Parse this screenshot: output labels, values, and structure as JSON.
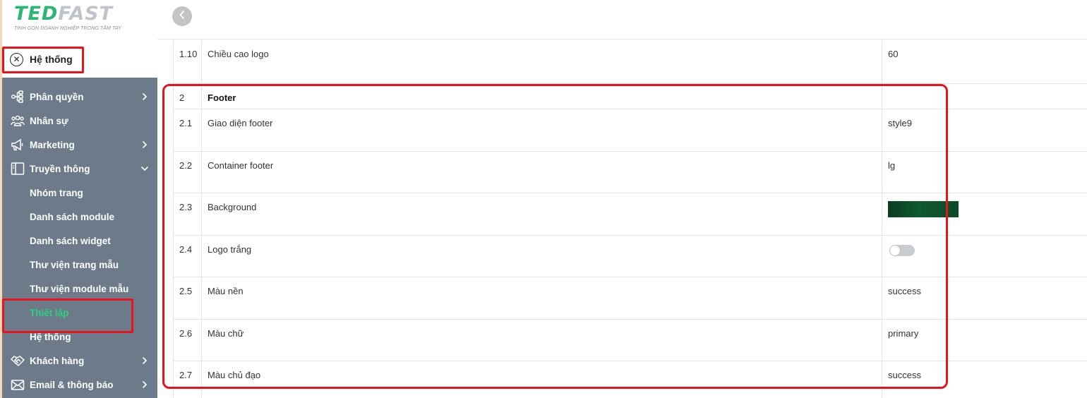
{
  "brand": {
    "logo_text_1": "TED",
    "logo_text_2": "FAST",
    "tagline": "TINH GỌN DOANH NGHIỆP TRONG TẦM TAY",
    "accent_color": "#2bb673",
    "highlight_color": "#e8141c"
  },
  "sidebar": {
    "header_label": "Hệ thống",
    "header_icon": "close-circle-icon",
    "items": [
      {
        "label": "Phân quyền",
        "icon": "share-nodes-icon",
        "chevron": "right"
      },
      {
        "label": "Nhân sự",
        "icon": "users-icon",
        "chevron": ""
      },
      {
        "label": "Marketing",
        "icon": "megaphone-icon",
        "chevron": "right"
      },
      {
        "label": "Truyền thông",
        "icon": "layout-icon",
        "chevron": "down"
      },
      {
        "label": "Nhóm trang",
        "sub": true
      },
      {
        "label": "Danh sách module",
        "sub": true
      },
      {
        "label": "Danh sách widget",
        "sub": true
      },
      {
        "label": "Thư viện trang mẫu",
        "sub": true
      },
      {
        "label": "Thư viện module mẫu",
        "sub": true
      },
      {
        "label": "Thiết lập",
        "sub": true,
        "active": true
      },
      {
        "label": "Hệ thống",
        "sub": true
      },
      {
        "label": "Khách hàng",
        "icon": "handshake-icon",
        "chevron": "right"
      },
      {
        "label": "Email & thông báo",
        "icon": "mail-icon",
        "chevron": "right"
      }
    ]
  },
  "topbar": {
    "back_icon": "chevron-left-icon"
  },
  "settings": {
    "rows": [
      {
        "no": "1.10",
        "name": "Chiều cao logo",
        "value": "60"
      },
      {
        "no": "2",
        "name": "Footer",
        "value": "",
        "section": true
      },
      {
        "no": "2.1",
        "name": "Giao diện footer",
        "value": "style9"
      },
      {
        "no": "2.2",
        "name": "Container footer",
        "value": "lg"
      },
      {
        "no": "2.3",
        "name": "Background",
        "value_type": "color",
        "value_color": "#0d4d2a"
      },
      {
        "no": "2.4",
        "name": "Logo trắng",
        "value_type": "toggle",
        "value_toggle": false
      },
      {
        "no": "2.5",
        "name": "Màu nền",
        "value": "success"
      },
      {
        "no": "2.6",
        "name": "Màu chữ",
        "value": "primary"
      },
      {
        "no": "2.7",
        "name": "Màu chủ đạo",
        "value": "success"
      }
    ]
  }
}
